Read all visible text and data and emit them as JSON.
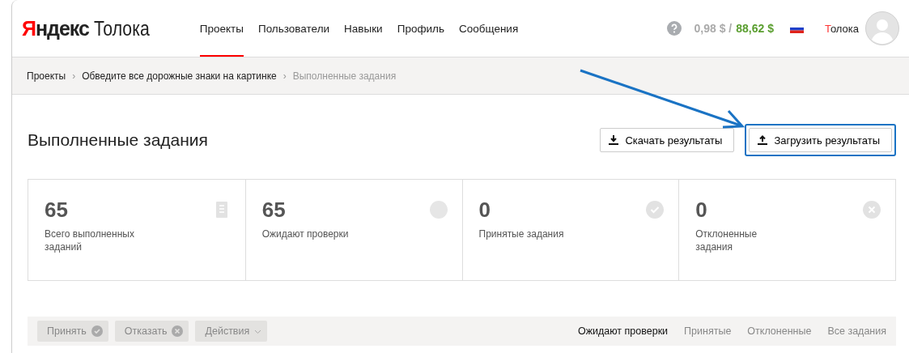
{
  "header": {
    "logo": {
      "brand": "Яндекс",
      "product": "Толока"
    },
    "nav": [
      {
        "label": "Проекты",
        "selected": true
      },
      {
        "label": "Пользователи",
        "selected": false
      },
      {
        "label": "Навыки",
        "selected": false
      },
      {
        "label": "Профиль",
        "selected": false
      },
      {
        "label": "Сообщения",
        "selected": false
      }
    ],
    "balance": {
      "pending": "0,98 $ /",
      "available": "88,62 $"
    },
    "user": {
      "name": "Толока"
    }
  },
  "breadcrumbs": [
    {
      "label": "Проекты",
      "current": false
    },
    {
      "separator": "›",
      "label": "Обведите все дорожные знаки на картинке",
      "current": false
    },
    {
      "separator": "›",
      "label": "Выполненные задания",
      "current": true
    }
  ],
  "page_title": "Выполненные задания",
  "actions": [
    {
      "label": "Скачать результаты",
      "kind": "download",
      "highlighted": false
    },
    {
      "label": "Загрузить результаты",
      "kind": "upload",
      "highlighted": true
    }
  ],
  "stats": [
    {
      "value": "65",
      "label": "Всего выполненных заданий",
      "kind": "total"
    },
    {
      "value": "65",
      "label": "Ожидают проверки",
      "kind": "pending"
    },
    {
      "value": "0",
      "label": "Принятые задания",
      "kind": "accepted"
    },
    {
      "value": "0",
      "label": "Отклоненные задания",
      "kind": "rejected"
    }
  ],
  "toolbar": {
    "buttons": [
      {
        "label": "Принять",
        "kind": "accept",
        "disabled": true
      },
      {
        "label": "Отказать",
        "kind": "reject",
        "disabled": true
      },
      {
        "label": "Действия",
        "kind": "menu",
        "disabled": true
      }
    ],
    "filters": [
      {
        "label": "Ожидают проверки",
        "selected": true
      },
      {
        "label": "Принятые",
        "selected": false
      },
      {
        "label": "Отклоненные",
        "selected": false
      },
      {
        "label": "Все задания",
        "selected": false
      }
    ]
  }
}
